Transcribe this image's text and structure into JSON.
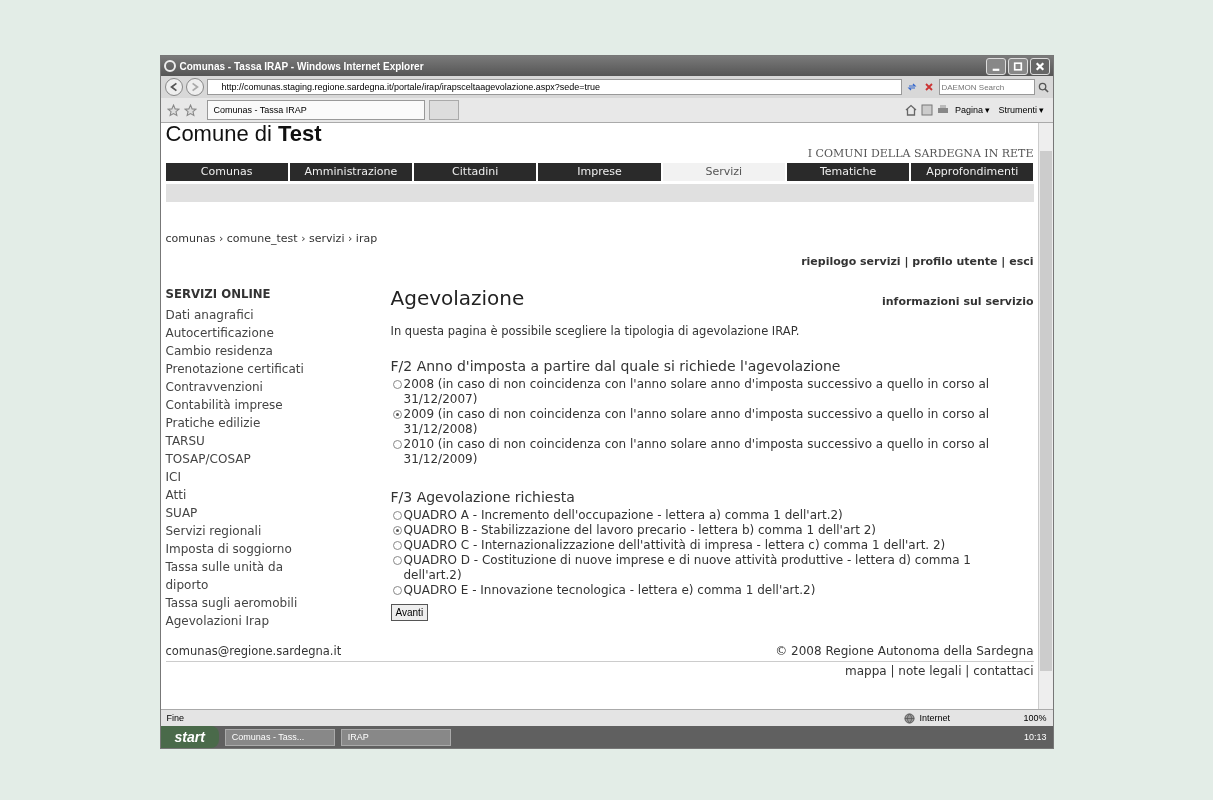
{
  "window": {
    "title": "Comunas - Tassa IRAP - Windows Internet Explorer"
  },
  "address_bar": {
    "url": "http://comunas.staging.regione.sardegna.it/portale/irap/irapsceltaagevolazione.aspx?sede=true",
    "search_placeholder": "DAEMON Search"
  },
  "browser_tab": {
    "label": "Comunas - Tassa IRAP"
  },
  "command_bar": [
    "Pagina ▾",
    "Strumenti ▾"
  ],
  "site": {
    "logo": "Comune di **Test**",
    "tagline": "I COMUNI DELLA SARDEGNA IN RETE"
  },
  "nav": [
    {
      "label": "Comunas",
      "selected": false
    },
    {
      "label": "Amministrazione",
      "selected": false
    },
    {
      "label": "Cittadini",
      "selected": false
    },
    {
      "label": "Imprese",
      "selected": false
    },
    {
      "label": "Servizi",
      "selected": true
    },
    {
      "label": "Tematiche",
      "selected": false
    },
    {
      "label": "Approfondimenti",
      "selected": false
    }
  ],
  "breadcrumb": "comunas › comune_test › servizi › irap",
  "user_links": "riepilogo servizi | profilo utente | esci",
  "sidebar": {
    "title": "SERVIZI ONLINE",
    "items": [
      "Dati anagrafici",
      "Autocertificazione",
      "Cambio residenza",
      "Prenotazione certificati",
      "Contravvenzioni",
      "Contabilità imprese",
      "Pratiche edilizie",
      "TARSU",
      "TOSAP/COSAP",
      "ICI",
      "Atti",
      "SUAP",
      "Servizi regionali",
      "Imposta di soggiorno",
      "Tassa sulle unità da diporto",
      "Tassa sugli aeromobili",
      "Agevolazioni Irap"
    ]
  },
  "main": {
    "title": "Agevolazione",
    "info_link": "informazioni sul servizio",
    "intro": "In questa pagina è possibile scegliere la tipologia di agevolazione IRAP.",
    "groups": [
      {
        "heading": "F/2 Anno d'imposta a partire dal quale si richiede l'agevolazione",
        "options": [
          {
            "label": "2008 (in caso di non coincidenza con l'anno solare anno d'imposta successivo a quello in corso al 31/12/2007)",
            "selected": false
          },
          {
            "label": "2009 (in caso di non coincidenza con l'anno solare anno d'imposta successivo a quello in corso al 31/12/2008)",
            "selected": true
          },
          {
            "label": "2010 (in caso di non coincidenza con l'anno solare anno d'imposta successivo a quello in corso al 31/12/2009)",
            "selected": false
          }
        ]
      },
      {
        "heading": "F/3 Agevolazione richiesta",
        "options": [
          {
            "label": "QUADRO A - Incremento dell'occupazione - lettera a) comma 1 dell'art.2)",
            "selected": false
          },
          {
            "label": "QUADRO B - Stabilizzazione del lavoro precario - lettera b) comma 1 dell'art 2)",
            "selected": true
          },
          {
            "label": "QUADRO C - Internazionalizzazione dell'attività di impresa - lettera c) comma 1 dell'art. 2)",
            "selected": false
          },
          {
            "label": "QUADRO D - Costituzione di nuove imprese e di nuove attività produttive - lettera d) comma 1 dell'art.2)",
            "selected": false
          },
          {
            "label": "QUADRO E - Innovazione tecnologica - lettera e) comma 1 dell'art.2)",
            "selected": false
          }
        ]
      }
    ],
    "button": "Avanti"
  },
  "footer": {
    "email": "comunas@regione.sardegna.it",
    "copyright": "© 2008 Regione Autonoma della Sardegna",
    "links": "mappa | note legali | contattaci"
  },
  "status_bar": {
    "status": "Fine",
    "zone": "Internet",
    "zoom": "100%"
  },
  "taskbar": {
    "start": "start",
    "tasks": [
      "Comunas - Tass...",
      "IRAP"
    ],
    "clock": "10:13"
  }
}
